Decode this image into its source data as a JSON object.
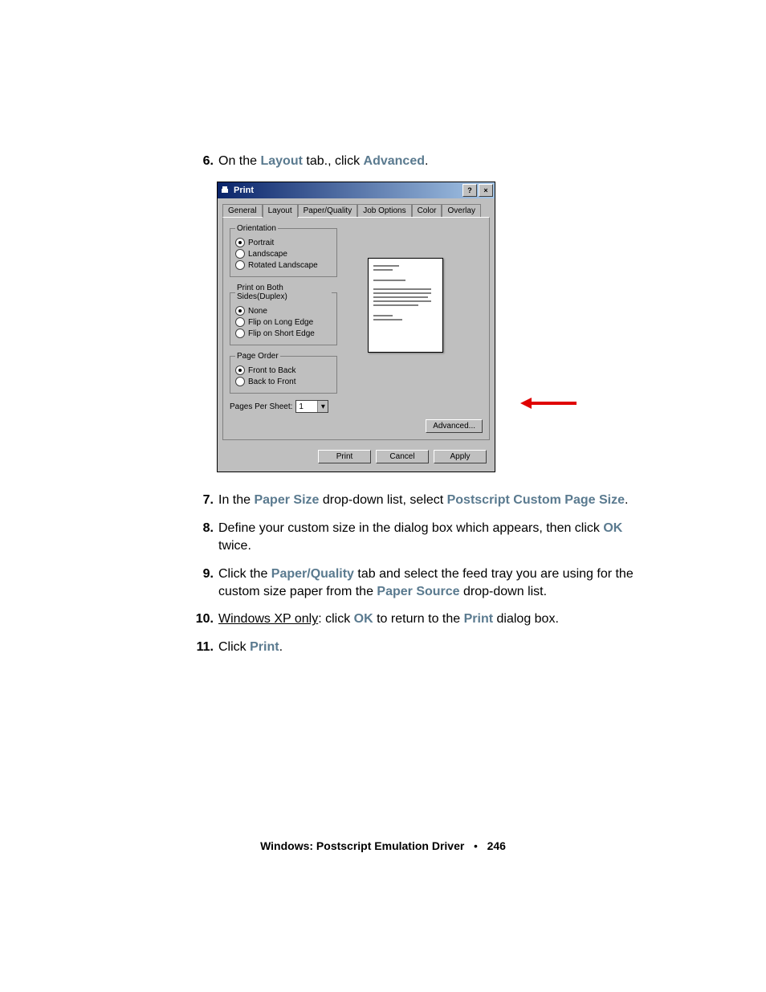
{
  "steps": {
    "s6": {
      "num": "6.",
      "t1": "On the ",
      "kw1": "Layout",
      "t2": " tab., click ",
      "kw2": "Advanced",
      "t3": "."
    },
    "s7": {
      "num": "7.",
      "t1": "In the ",
      "kw1": "Paper Size",
      "t2": " drop-down list, select ",
      "kw2": "Postscript Custom Page Size",
      "t3": "."
    },
    "s8": {
      "num": "8.",
      "t1": "Define your custom size in the dialog box which appears, then click ",
      "kw1": "OK",
      "t2": " twice."
    },
    "s9": {
      "num": "9.",
      "t1": "Click the ",
      "kw1": "Paper/Quality",
      "t2": " tab and select the feed tray you are using for the custom size paper from the ",
      "kw2": "Paper Source",
      "t3": " drop-down list."
    },
    "s10": {
      "num": "10.",
      "u1": "Windows XP only",
      "t1": ": click ",
      "kw1": "OK",
      "t2": " to return to the ",
      "kw2": "Print",
      "t3": " dialog box."
    },
    "s11": {
      "num": "11.",
      "t1": "Click ",
      "kw1": "Print",
      "t2": "."
    }
  },
  "dialog": {
    "title": "Print",
    "titlebar_help": "?",
    "titlebar_close": "×",
    "tabs": [
      "General",
      "Layout",
      "Paper/Quality",
      "Job Options",
      "Color",
      "Overlay"
    ],
    "orientation": {
      "legend": "Orientation",
      "opts": [
        "Portrait",
        "Landscape",
        "Rotated Landscape"
      ],
      "selected": 0
    },
    "duplex": {
      "legend": "Print on Both Sides(Duplex)",
      "opts": [
        "None",
        "Flip on Long Edge",
        "Flip on Short Edge"
      ],
      "selected": 0
    },
    "pageorder": {
      "legend": "Page Order",
      "opts": [
        "Front to Back",
        "Back to Front"
      ],
      "selected": 0
    },
    "pps_label": "Pages Per Sheet:",
    "pps_value": "1",
    "advanced_btn": "Advanced...",
    "buttons": [
      "Print",
      "Cancel",
      "Apply"
    ]
  },
  "footer": {
    "title": "Windows: Postscript Emulation Driver",
    "sep": "•",
    "page": "246"
  }
}
